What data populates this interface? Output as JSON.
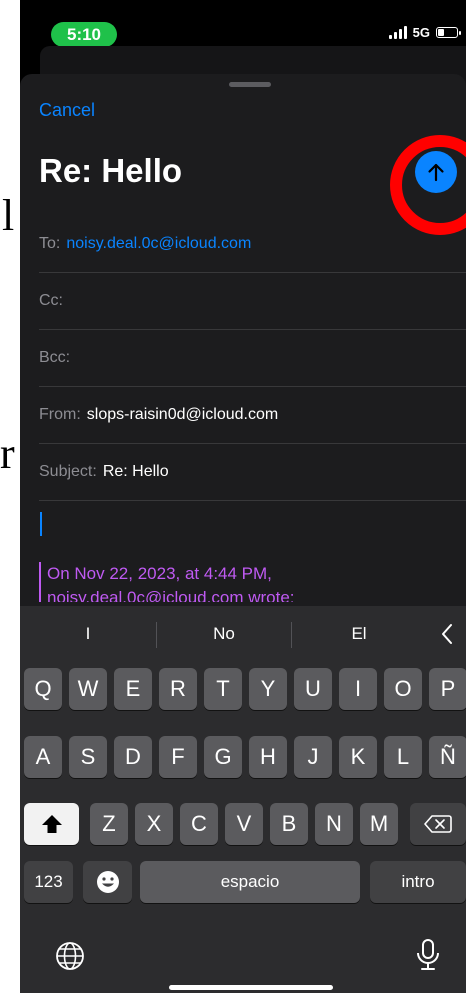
{
  "status_bar": {
    "time": "5:10",
    "network": "5G"
  },
  "compose": {
    "cancel_label": "Cancel",
    "title": "Re: Hello",
    "to_label": "To:",
    "to_value": "noisy.deal.0c@icloud.com",
    "cc_label": "Cc:",
    "bcc_label": "Bcc:",
    "from_label": "From:",
    "from_value": "slops-raisin0d@icloud.com",
    "subject_label": "Subject:",
    "subject_value": "Re: Hello",
    "quote_line1": "On Nov 22, 2023, at 4:44 PM,",
    "quote_line2": "noisy.deal.0c@icloud.com wrote:"
  },
  "keyboard": {
    "suggestions": [
      "I",
      "No",
      "El"
    ],
    "row1": [
      "Q",
      "W",
      "E",
      "R",
      "T",
      "Y",
      "U",
      "I",
      "O",
      "P"
    ],
    "row2": [
      "A",
      "S",
      "D",
      "F",
      "G",
      "H",
      "J",
      "K",
      "L",
      "Ñ"
    ],
    "row3": [
      "Z",
      "X",
      "C",
      "V",
      "B",
      "N",
      "M"
    ],
    "numbers_label": "123",
    "space_label": "espacio",
    "return_label": "intro"
  },
  "colors": {
    "accent": "#0a84ff",
    "status_green": "#1fc14a",
    "highlight_ring": "#ff0000",
    "quote": "#bf5af2"
  },
  "icons": {
    "send": "arrow-up-icon",
    "shift": "shift-icon",
    "delete": "backspace-icon",
    "emoji": "emoji-icon",
    "globe": "globe-icon",
    "mic": "microphone-icon",
    "collapse": "chevron-left-icon"
  }
}
